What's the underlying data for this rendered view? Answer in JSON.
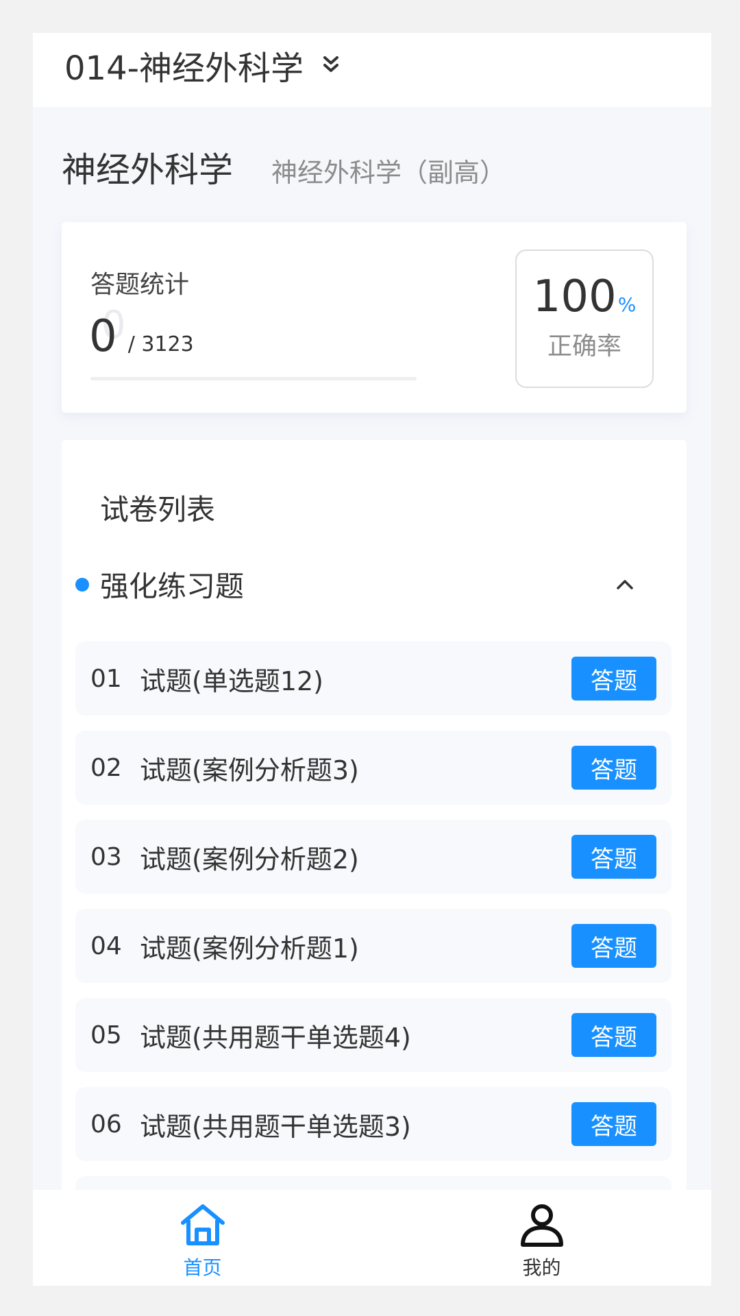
{
  "header": {
    "title": "014-神经外科学"
  },
  "subject": {
    "name": "神经外科学",
    "level": "神经外科学（副高）"
  },
  "stats": {
    "label": "答题统计",
    "answered": "0",
    "total": "/ 3123",
    "ghost_value": "0",
    "progress": 0,
    "accuracy_value": "100",
    "accuracy_unit": "%",
    "accuracy_label": "正确率"
  },
  "papers": {
    "title": "试卷列表",
    "group_title": "强化练习题",
    "button_label": "答题",
    "items": [
      {
        "no": "01",
        "name": "试题(单选题12)"
      },
      {
        "no": "02",
        "name": "试题(案例分析题3)"
      },
      {
        "no": "03",
        "name": "试题(案例分析题2)"
      },
      {
        "no": "04",
        "name": "试题(案例分析题1)"
      },
      {
        "no": "05",
        "name": "试题(共用题干单选题4)"
      },
      {
        "no": "06",
        "name": "试题(共用题干单选题3)"
      }
    ]
  },
  "tabbar": {
    "home": {
      "label": "首页",
      "icon": "home-icon"
    },
    "mine": {
      "label": "我的",
      "icon": "user-icon"
    }
  },
  "colors": {
    "accent": "#1890ff"
  }
}
